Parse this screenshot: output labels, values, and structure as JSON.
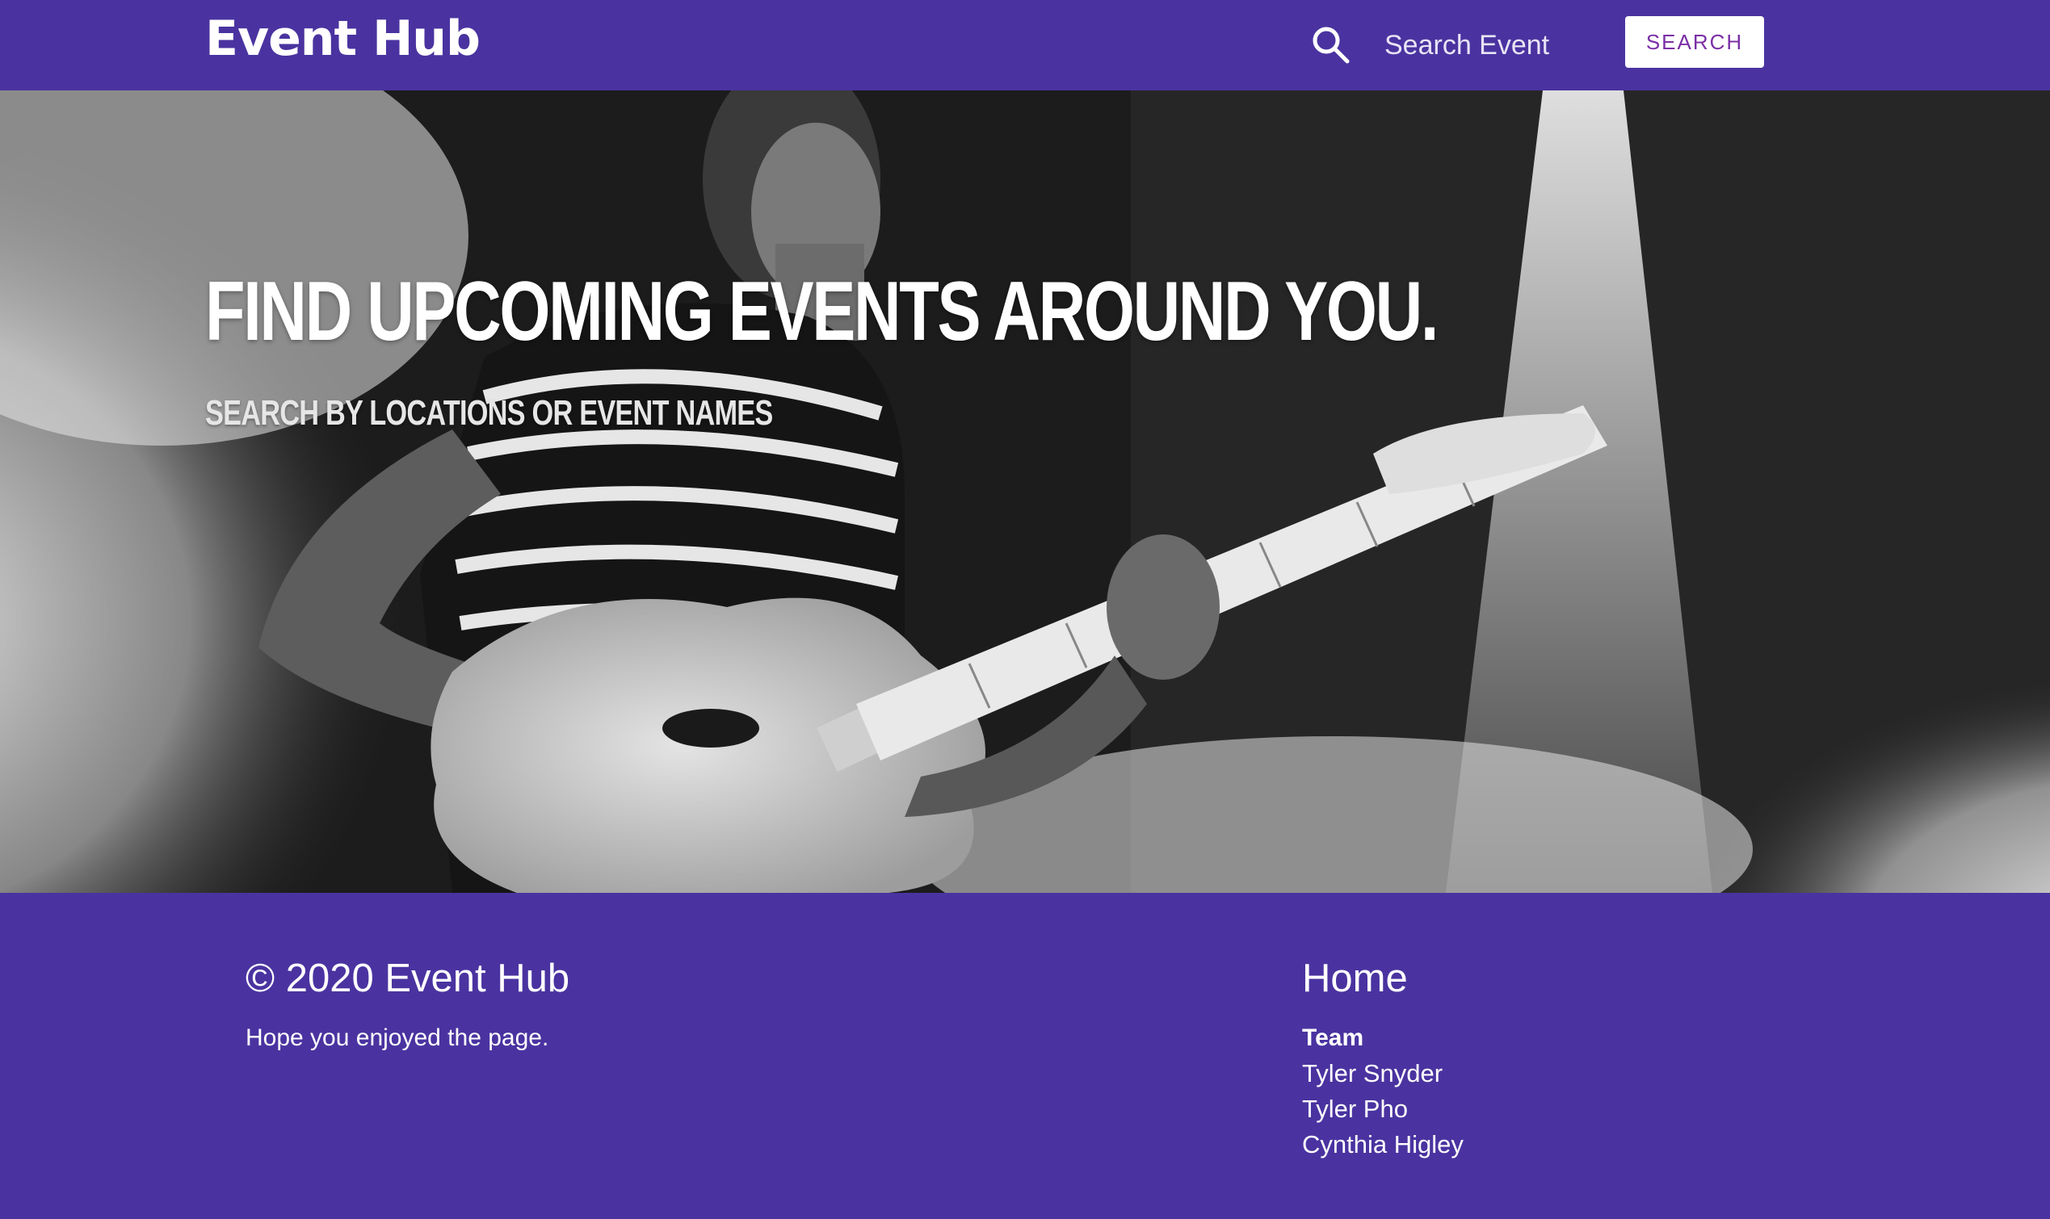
{
  "header": {
    "brand": "Event Hub",
    "search_placeholder": "Search Event",
    "search_button_label": "SEARCH",
    "search_icon": "search-icon"
  },
  "hero": {
    "title": "FIND UPCOMING EVENTS AROUND YOU.",
    "subtitle": "SEARCH BY LOCATIONS OR EVENT NAMES",
    "background": "black-and-white photo of a guitarist playing an electric guitar on a smoky stage"
  },
  "footer": {
    "copyright": "© 2020 Event Hub",
    "tagline": "Hope you enjoyed the page.",
    "home_link": "Home",
    "team_heading": "Team",
    "team_members": [
      "Tyler Snyder",
      "Tyler Pho",
      "Cynthia Higley"
    ]
  },
  "colors": {
    "brand_purple": "#4a33a0",
    "button_text": "#7b2fa6",
    "white": "#ffffff"
  }
}
